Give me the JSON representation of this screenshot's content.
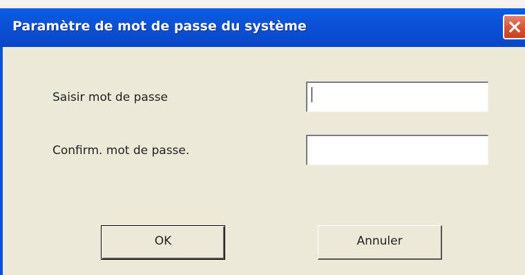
{
  "window": {
    "title": "Paramètre de mot de passe du système"
  },
  "form": {
    "password_label": "Saisir mot de passe",
    "password_value": "",
    "confirm_label": "Confirm. mot de passe.",
    "confirm_value": ""
  },
  "buttons": {
    "ok_label": "OK",
    "cancel_label": "Annuler"
  },
  "icons": {
    "close": "close-icon"
  },
  "colors": {
    "titlebar": "#0a52d8",
    "close_button": "#d95a3c",
    "dialog_background": "#ece9d8"
  }
}
